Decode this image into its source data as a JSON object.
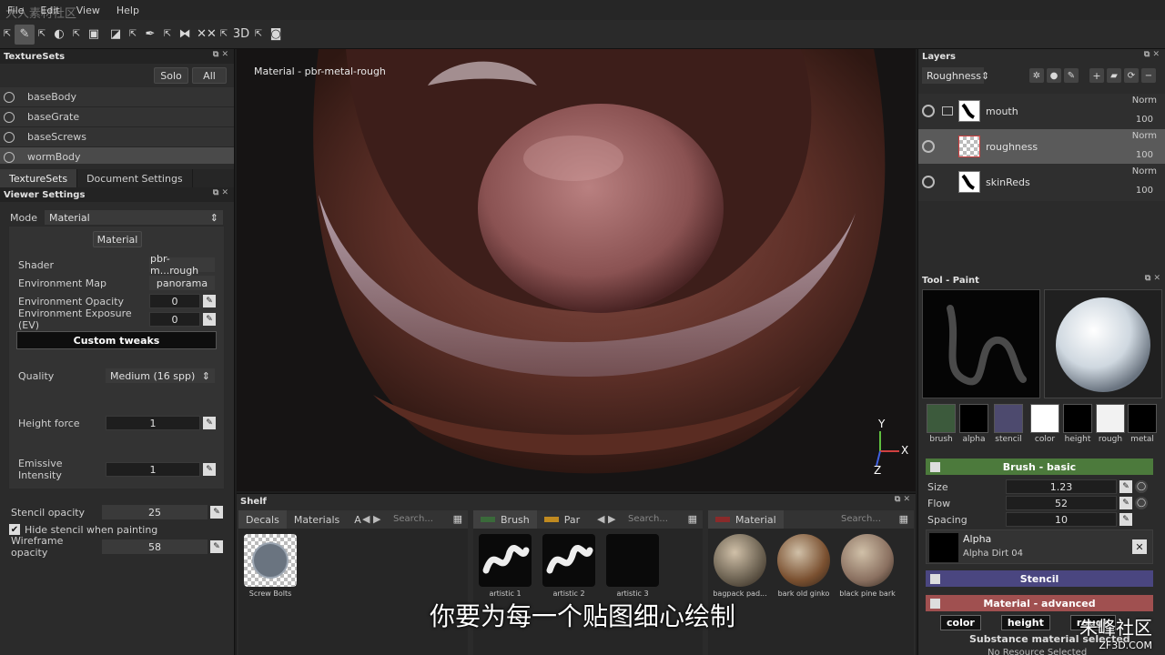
{
  "menu": [
    "File",
    "Edit",
    "View",
    "Help"
  ],
  "toolbar": {
    "tools": [
      "export-icon",
      "brush-icon",
      "export-icon",
      "eraser-icon",
      "export-icon",
      "image-icon",
      "stamp-icon",
      "export-icon",
      "eyedropper-icon",
      "export-icon",
      "symmetry-icon",
      "xx-icon",
      "export-icon",
      "3d-icon",
      "export-icon",
      "camera-icon"
    ],
    "glyphs": [
      "⇱",
      "✎",
      "⇱",
      "◐",
      "⇱",
      "▣",
      "◪",
      "⇱",
      "✒",
      "⇱",
      "⧓",
      "✕✕",
      "⇱",
      "3D",
      "⇱",
      "◙"
    ]
  },
  "texturesets": {
    "title": "TextureSets",
    "solo": "Solo",
    "all": "All",
    "items": [
      {
        "name": "baseBody",
        "selected": false
      },
      {
        "name": "baseGrate",
        "selected": false
      },
      {
        "name": "baseScrews",
        "selected": false
      },
      {
        "name": "wormBody",
        "selected": true
      }
    ],
    "tabs": [
      "TextureSets",
      "Document Settings"
    ]
  },
  "viewer": {
    "title": "Viewer Settings",
    "mode_label": "Mode",
    "mode_value": "Material",
    "material_btn": "Material",
    "shader_label": "Shader",
    "shader_value": "pbr-m...rough",
    "envmap_label": "Environment Map",
    "envmap_value": "panorama",
    "envop_label": "Environment Opacity",
    "envop_value": "0",
    "envexp_label": "Environment Exposure (EV)",
    "envexp_value": "0",
    "custom_tweaks": "Custom tweaks",
    "quality_label": "Quality",
    "quality_value": "Medium (16 spp)",
    "height_label": "Height force",
    "height_value": "1",
    "emissive_label": "Emissive Intensity",
    "emissive_value": "1",
    "stencil_label": "Stencil opacity",
    "stencil_value": "25",
    "hide_stencil_label": "Hide stencil when painting",
    "wire_label": "Wireframe opacity",
    "wire_value": "58"
  },
  "viewport": {
    "label": "Material - pbr-metal-rough",
    "axis_y": "Y",
    "axis_x": "X",
    "axis_z": "Z"
  },
  "layers": {
    "title": "Layers",
    "channel": "Roughness",
    "items": [
      {
        "name": "mouth",
        "blend": "Norm",
        "opacity": "100",
        "selected": false
      },
      {
        "name": "roughness",
        "blend": "Norm",
        "opacity": "100",
        "selected": true
      },
      {
        "name": "skinReds",
        "blend": "Norm",
        "opacity": "100",
        "selected": false
      }
    ]
  },
  "tool": {
    "title": "Tool - Paint",
    "channels": [
      {
        "label": "brush",
        "color": "#3c5a3c"
      },
      {
        "label": "alpha",
        "color": "#000000"
      },
      {
        "label": "stencil",
        "color": "#4d4a6e"
      },
      {
        "label": "color",
        "color": "#ffffff"
      },
      {
        "label": "height",
        "color": "#000000"
      },
      {
        "label": "rough",
        "color": "#f2f2f2"
      },
      {
        "label": "metal",
        "color": "#000000"
      }
    ],
    "brush_section": "Brush - basic",
    "size_label": "Size",
    "size_value": "1.23",
    "flow_label": "Flow",
    "flow_value": "52",
    "spacing_label": "Spacing",
    "spacing_value": "10",
    "alpha_label": "Alpha",
    "alpha_name": "Alpha Dirt 04",
    "stencil_section": "Stencil",
    "material_section": "Material - advanced",
    "mat_buttons": [
      "color",
      "height",
      "rough"
    ],
    "substance_text": "Substance material selected",
    "no_resource": "No Resource Selected"
  },
  "shelf": {
    "title": "Shelf",
    "left_tabs": [
      "Decals",
      "Materials",
      "A"
    ],
    "left_search": "Search...",
    "decal_item": "Screw Bolts",
    "mid_tabs": [
      "Brush",
      "Par"
    ],
    "mid_search": "Search...",
    "brushes": [
      "artistic 1",
      "artistic 2",
      "artistic 3"
    ],
    "right_tab": "Material",
    "right_search": "Search...",
    "materials": [
      "bagpack pad...",
      "bark old ginko",
      "black pine bark"
    ]
  },
  "subtitle": "你要为每一个贴图细心绘制",
  "watermark": {
    "site": "朱峰社区",
    "url": "ZF3D.COM",
    "topleft": "大人素材社区"
  }
}
